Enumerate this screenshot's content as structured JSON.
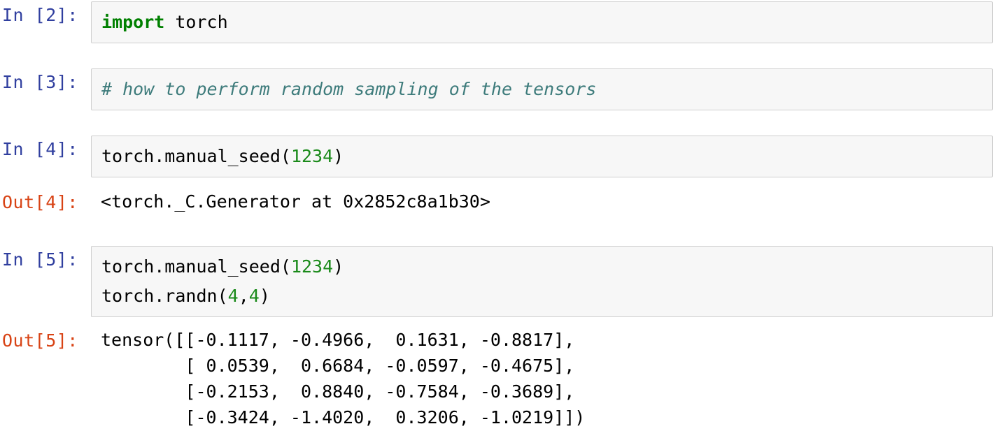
{
  "notebook": {
    "cells": [
      {
        "id": "cell-in-2",
        "type": "input",
        "prompt": "In [2]:",
        "lines": [
          [
            {
              "text": "import",
              "token": "keyword"
            },
            {
              "text": " torch",
              "token": "plain"
            }
          ]
        ]
      },
      {
        "id": "cell-in-3",
        "type": "input",
        "prompt": "In [3]:",
        "lines": [
          [
            {
              "text": "# how to perform random sampling of the tensors",
              "token": "comment"
            }
          ]
        ]
      },
      {
        "id": "cell-in-4",
        "type": "input",
        "prompt": "In [4]:",
        "lines": [
          [
            {
              "text": "torch.manual_seed(",
              "token": "plain"
            },
            {
              "text": "1234",
              "token": "number"
            },
            {
              "text": ")",
              "token": "plain"
            }
          ]
        ]
      },
      {
        "id": "cell-out-4",
        "type": "output",
        "prompt": "Out[4]:",
        "text": "<torch._C.Generator at 0x2852c8a1b30>"
      },
      {
        "id": "cell-in-5",
        "type": "input",
        "prompt": "In [5]:",
        "lines": [
          [
            {
              "text": "torch.manual_seed(",
              "token": "plain"
            },
            {
              "text": "1234",
              "token": "number"
            },
            {
              "text": ")",
              "token": "plain"
            }
          ],
          [
            {
              "text": "torch.randn(",
              "token": "plain"
            },
            {
              "text": "4",
              "token": "number"
            },
            {
              "text": ",",
              "token": "plain"
            },
            {
              "text": "4",
              "token": "number"
            },
            {
              "text": ")",
              "token": "plain"
            }
          ]
        ]
      },
      {
        "id": "cell-out-5",
        "type": "output",
        "prompt": "Out[5]:",
        "text": "tensor([[-0.1117, -0.4966,  0.1631, -0.8817],\n        [ 0.0539,  0.6684, -0.0597, -0.4675],\n        [-0.2153,  0.8840, -0.7584, -0.3689],\n        [-0.3424, -1.4020,  0.3206, -1.0219]])"
      }
    ]
  },
  "tensor_values": [
    [
      -0.1117,
      -0.4966,
      0.1631,
      -0.8817
    ],
    [
      0.0539,
      0.6684,
      -0.0597,
      -0.4675
    ],
    [
      -0.2153,
      0.884,
      -0.7584,
      -0.3689
    ],
    [
      -0.3424,
      -1.402,
      0.3206,
      -1.0219
    ]
  ],
  "colors": {
    "in_prompt": "#303F9F",
    "out_prompt": "#D84315",
    "keyword": "#008000",
    "number": "#1a8a1a",
    "comment": "#3D7B7B",
    "cell_background": "#f7f7f7",
    "cell_border": "#cfcfcf",
    "page_background": "#ffffff"
  }
}
